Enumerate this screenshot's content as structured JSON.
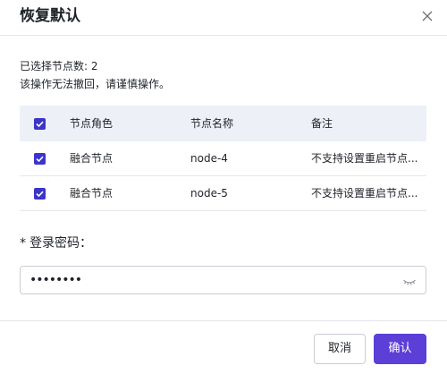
{
  "dialog": {
    "title": "恢复默认"
  },
  "info": {
    "selected": "已选择节点数: 2",
    "warning": "该操作无法撤回，请谨慎操作。"
  },
  "table": {
    "headers": [
      "节点角色",
      "节点名称",
      "备注"
    ],
    "rows": [
      {
        "role": "融合节点",
        "name": "node-4",
        "note": "不支持设置重启节点..."
      },
      {
        "role": "融合节点",
        "name": "node-5",
        "note": "不支持设置重启节点..."
      }
    ]
  },
  "password": {
    "required_mark": "*",
    "label": "登录密码：",
    "value": "••••••••"
  },
  "buttons": {
    "cancel": "取消",
    "ok": "确认"
  },
  "colors": {
    "accent": "#5b3fd6",
    "checkbox": "#3d34c9",
    "table_header_bg": "#eef0f8"
  },
  "icons": {
    "close": "close-icon",
    "checkbox": "checkbox-checked-icon",
    "password_toggle": "eye-closed-icon"
  }
}
